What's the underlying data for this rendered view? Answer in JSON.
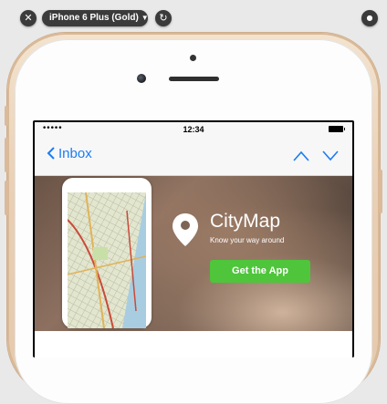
{
  "simulator": {
    "device_label": "iPhone 6 Plus (Gold)",
    "close_glyph": "✕",
    "rotate_glyph": "↻",
    "home_glyph": "●"
  },
  "status_bar": {
    "signal": "•••••",
    "time": "12:34"
  },
  "nav": {
    "back_label": "Inbox"
  },
  "banner": {
    "app_name": "CityMap",
    "tagline": "Know your way around",
    "cta_label": "Get the App"
  },
  "colors": {
    "link": "#1a7cf5",
    "cta": "#4ec53b",
    "phone_body": "#e9cfb4"
  }
}
